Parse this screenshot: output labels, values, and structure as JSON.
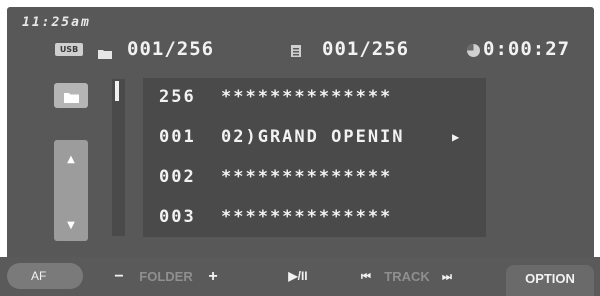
{
  "clock": "11:25am",
  "status": {
    "usb_label": "USB",
    "folder_counter": "001/256",
    "track_counter": "001/256",
    "elapsed_time": "0:00:27"
  },
  "list": [
    {
      "number": "256",
      "title": "**************",
      "playing": false
    },
    {
      "number": "001",
      "title": "02)GRAND OPENIN",
      "playing": true
    },
    {
      "number": "002",
      "title": "**************",
      "playing": false
    },
    {
      "number": "003",
      "title": "**************",
      "playing": false
    }
  ],
  "sidebar": {
    "up_arrow": "▲",
    "down_arrow": "▼"
  },
  "playing_indicator": "▶",
  "bottom": {
    "af_label": "AF",
    "folder_minus": "−",
    "folder_label": "FOLDER",
    "folder_plus": "+",
    "play_pause": "▶/II",
    "track_prev": "⏮",
    "track_label": "TRACK",
    "track_next": "⏭",
    "option_label": "OPTION"
  },
  "colors": {
    "screen_bg": "#585858",
    "panel_bg": "#4a4a4a",
    "text": "#f2f2f2",
    "dim_text": "#8f8f8f"
  }
}
